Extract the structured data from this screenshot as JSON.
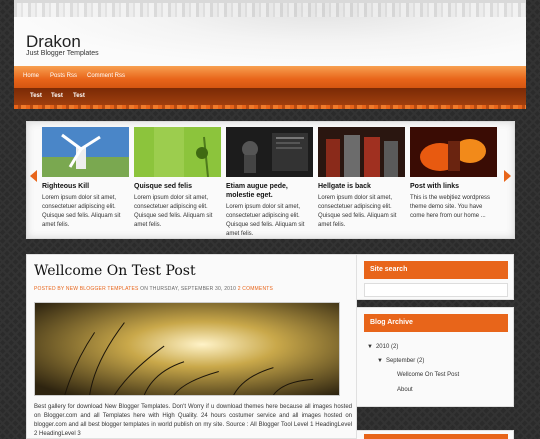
{
  "header": {
    "title": "Drakon",
    "description": "Just Blogger Templates"
  },
  "nav": {
    "links": [
      "Home",
      "Posts Rss",
      "Comment Rss"
    ],
    "tabs": [
      "Test",
      "Test",
      "Test"
    ]
  },
  "slider": {
    "items": [
      {
        "title": "Righteous Kill",
        "text": "Lorem ipsum dolor sit amet, consectetuer adipiscing elit. Quisque sed felis. Aliquam sit amet felis."
      },
      {
        "title": "Quisque sed felis",
        "text": "Lorem ipsum dolor sit amet, consectetuer adipiscing elit. Quisque sed felis. Aliquam sit amet felis."
      },
      {
        "title": "Etiam augue pede, molestie eget.",
        "text": "Lorem ipsum dolor sit amet, consectetuer adipiscing elit. Quisque sed felis. Aliquam sit amet felis."
      },
      {
        "title": "Hellgate is back",
        "text": "Lorem ipsum dolor sit amet, consectetuer adipiscing elit. Quisque sed felis. Aliquam sit amet felis."
      },
      {
        "title": "Post with links",
        "text": "This is the webjtiez wordpress theme demo site. You have come here from our home ..."
      }
    ]
  },
  "post": {
    "title": "Wellcome On Test Post",
    "meta_author": "POSTED BY NEW BLOGGER TEMPLATES",
    "meta_date": "ON THURSDAY, SEPTEMBER 30, 2010",
    "meta_comments": "2 COMMENTS",
    "body": "Best gallery for download New Blogger Templates. Don't Worry if u download themes here because all images hosted on Blogger.com and all Templates here with High Quality. 24 hours costumer service and all images hosted on blogger.com and all best blogger templates in world publish on my site. Source : All Blogger Tool Level 1 HeadingLevel 2 HeadingLevel 3"
  },
  "sidebar": {
    "search_title": "Site search",
    "archive_title": "Blog Archive",
    "archive_year": "2010",
    "archive_year_count": "(2)",
    "archive_month": "September",
    "archive_month_count": "(2)",
    "archive_posts": [
      "Wellcome On Test Post",
      "About"
    ]
  },
  "colors": {
    "accent": "#e8651a",
    "nav_dark": "#8f3608"
  }
}
